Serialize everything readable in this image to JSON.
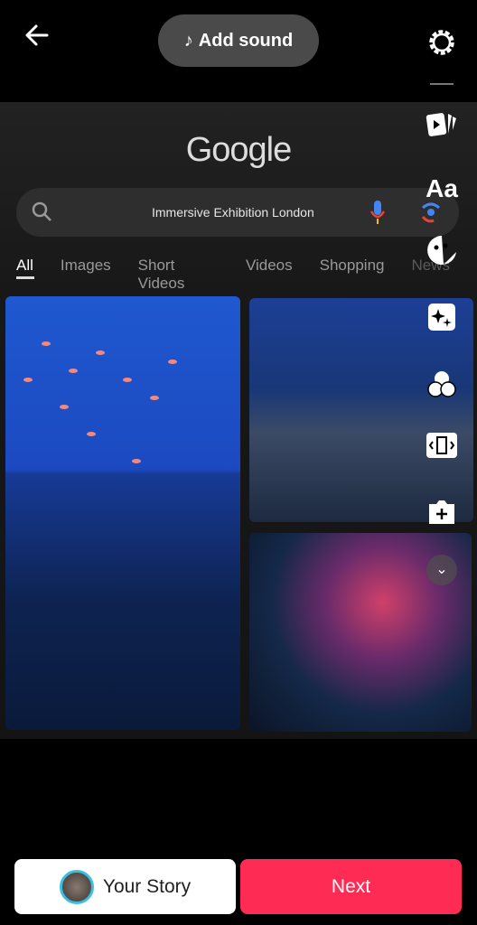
{
  "top_bar": {
    "back_icon": "arrow-left",
    "add_sound_label": "Add sound",
    "music_icon": "music-note",
    "settings_icon": "gear"
  },
  "side_tools": [
    "templates-icon",
    "text-icon",
    "sticker-icon",
    "effects-icon",
    "filters-icon",
    "crop-icon",
    "camera-add-icon",
    "more-chevron-icon"
  ],
  "text_tool_label": "Aa",
  "screenshot": {
    "logo": "Google",
    "search_query": "Immersive Exhibition London",
    "tabs": [
      "All",
      "Images",
      "Short Videos",
      "Videos",
      "Shopping",
      "News"
    ],
    "active_tab": "All"
  },
  "bottom": {
    "your_story_label": "Your Story",
    "next_label": "Next",
    "next_color": "#fe2c55"
  }
}
